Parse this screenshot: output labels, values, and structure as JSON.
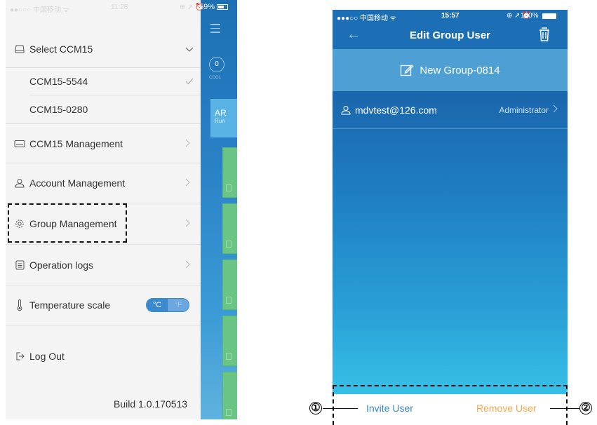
{
  "left_phone": {
    "status": {
      "carrier": "●●○○○ 中国移动 ᯤ",
      "time": "11:28",
      "icons": "⊕ ➚ ⏰",
      "battery": "59%"
    },
    "drawer": {
      "select_title": "Select CCM15",
      "ccm_items": [
        {
          "label": "CCM15-5544",
          "selected": true
        },
        {
          "label": "CCM15-0280",
          "selected": false
        }
      ],
      "menu_items": [
        {
          "label": "CCM15 Management",
          "icon": "keyboard-icon"
        },
        {
          "label": "Account Management",
          "icon": "person-icon"
        },
        {
          "label": "Group Management",
          "icon": "gear-icon"
        },
        {
          "label": "Operation logs",
          "icon": "document-icon"
        }
      ],
      "temperature": {
        "label": "Temperature scale",
        "celsius": "°C",
        "fahrenheit": "°F",
        "selected": "°C"
      },
      "logout": "Log Out",
      "build": "Build 1.0.170513"
    },
    "peek": {
      "mode_value": "0",
      "mode_label": "COOL",
      "card_title": "AR",
      "card_sub": "Run"
    }
  },
  "right_phone": {
    "status": {
      "carrier": "●●●○○ 中国移动 ᯤ",
      "time": "15:57",
      "icons": "⊕ ➚ ⏰",
      "battery": "100%"
    },
    "header": {
      "title": "Edit Group User",
      "back": "←"
    },
    "group_name": "New Group-0814",
    "users": [
      {
        "email": "mdvtest@126.com",
        "role": "Administrator"
      }
    ],
    "footer": {
      "invite": "Invite User",
      "remove": "Remove User"
    }
  },
  "callouts": [
    "①",
    "②"
  ],
  "colors": {
    "header_blue": "#1d6fb5",
    "invite_blue": "#3a8ad0",
    "remove_orange": "#f2a94a",
    "drawer_bg": "#f4f4f4"
  }
}
